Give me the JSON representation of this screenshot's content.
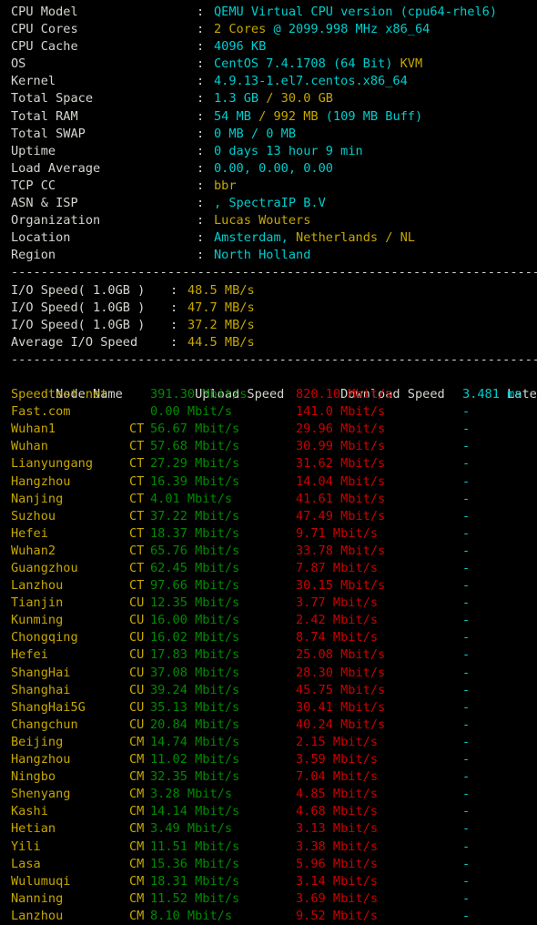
{
  "terminal": {
    "background": "#000000",
    "colors": {
      "white": "#d3d7cf",
      "cyan": "#00cdcd",
      "yellow": "#c6a700",
      "green": "#008b00",
      "red": "#cd0000"
    },
    "separator": "---------------------------------------------------------------------"
  },
  "system_info": [
    {
      "label": "CPU Model",
      "colon": ":",
      "parts": [
        {
          "text": "QEMU Virtual CPU version (cpu64-rhel6)",
          "color": "cy"
        }
      ]
    },
    {
      "label": "CPU Cores",
      "colon": ":",
      "parts": [
        {
          "text": "2 Cores",
          "color": "ye"
        },
        {
          "text": " @ 2099.998 MHz x86_64",
          "color": "cy"
        }
      ]
    },
    {
      "label": "CPU Cache",
      "colon": ":",
      "parts": [
        {
          "text": "4096 KB",
          "color": "cy"
        }
      ]
    },
    {
      "label": "OS",
      "colon": ":",
      "parts": [
        {
          "text": "CentOS 7.4.1708 (64 Bit) ",
          "color": "cy"
        },
        {
          "text": "KVM",
          "color": "ye"
        }
      ]
    },
    {
      "label": "Kernel",
      "colon": ":",
      "parts": [
        {
          "text": "4.9.13-1.el7.centos.x86_64",
          "color": "cy"
        }
      ]
    },
    {
      "label": "Total Space",
      "colon": ":",
      "parts": [
        {
          "text": "1.3 GB ",
          "color": "cy"
        },
        {
          "text": "/ 30.0 GB",
          "color": "ye"
        }
      ]
    },
    {
      "label": "Total RAM",
      "colon": ":",
      "parts": [
        {
          "text": "54 MB ",
          "color": "cy"
        },
        {
          "text": "/ 992 MB ",
          "color": "ye"
        },
        {
          "text": "(109 MB Buff)",
          "color": "cy"
        }
      ]
    },
    {
      "label": "Total SWAP",
      "colon": ":",
      "parts": [
        {
          "text": "0 MB / 0 MB",
          "color": "cy"
        }
      ]
    },
    {
      "label": "Uptime",
      "colon": ":",
      "parts": [
        {
          "text": "0 days 13 hour 9 min",
          "color": "cy"
        }
      ]
    },
    {
      "label": "Load Average",
      "colon": ":",
      "parts": [
        {
          "text": "0.00, 0.00, 0.00",
          "color": "cy"
        }
      ]
    },
    {
      "label": "TCP CC",
      "colon": ":",
      "parts": [
        {
          "text": "bbr",
          "color": "ye"
        }
      ]
    },
    {
      "label": "ASN & ISP",
      "colon": ":",
      "parts": [
        {
          "text": ", SpectraIP B.V",
          "color": "cy"
        }
      ]
    },
    {
      "label": "Organization",
      "colon": ":",
      "parts": [
        {
          "text": "Lucas Wouters",
          "color": "ye"
        }
      ]
    },
    {
      "label": "Location",
      "colon": ":",
      "parts": [
        {
          "text": "Amsterdam, ",
          "color": "cy"
        },
        {
          "text": "Netherlands / NL",
          "color": "ye"
        }
      ]
    },
    {
      "label": "Region",
      "colon": ":",
      "parts": [
        {
          "text": "North Holland",
          "color": "cy"
        }
      ]
    }
  ],
  "io_tests": [
    {
      "label": "I/O Speed( 1.0GB )",
      "colon": ":",
      "value": "48.5 MB/s"
    },
    {
      "label": "I/O Speed( 1.0GB )",
      "colon": ":",
      "value": "47.7 MB/s"
    },
    {
      "label": "I/O Speed( 1.0GB )",
      "colon": ":",
      "value": "37.2 MB/s"
    },
    {
      "label": "Average I/O Speed",
      "colon": ":",
      "value": "44.5 MB/s"
    }
  ],
  "speedtest": {
    "headers": {
      "node": "Node Name",
      "isp": "",
      "upload": "Upload Speed",
      "download": "Download Speed",
      "latency": "Latency"
    },
    "rows": [
      {
        "node": "Speedtest.net",
        "isp": "",
        "upload": "391.30 Mbit/s",
        "download": "820.10 Mbit/s",
        "latency": "3.481 ms"
      },
      {
        "node": "Fast.com",
        "isp": "",
        "upload": "0.00 Mbit/s",
        "download": "141.0 Mbit/s",
        "latency": "-"
      },
      {
        "node": "Wuhan1",
        "isp": "CT",
        "upload": "56.67 Mbit/s",
        "download": "29.96 Mbit/s",
        "latency": "-"
      },
      {
        "node": "Wuhan",
        "isp": "CT",
        "upload": "57.68 Mbit/s",
        "download": "30.99 Mbit/s",
        "latency": "-"
      },
      {
        "node": "Lianyungang",
        "isp": "CT",
        "upload": "27.29 Mbit/s",
        "download": "31.62 Mbit/s",
        "latency": "-"
      },
      {
        "node": "Hangzhou",
        "isp": "CT",
        "upload": "16.39 Mbit/s",
        "download": "14.04 Mbit/s",
        "latency": "-"
      },
      {
        "node": "Nanjing",
        "isp": "CT",
        "upload": "4.01 Mbit/s",
        "download": "41.61 Mbit/s",
        "latency": "-"
      },
      {
        "node": "Suzhou",
        "isp": "CT",
        "upload": "37.22 Mbit/s",
        "download": "47.49 Mbit/s",
        "latency": "-"
      },
      {
        "node": "Hefei",
        "isp": "CT",
        "upload": "18.37 Mbit/s",
        "download": "9.71 Mbit/s",
        "latency": "-"
      },
      {
        "node": "Wuhan2",
        "isp": "CT",
        "upload": "65.76 Mbit/s",
        "download": "33.78 Mbit/s",
        "latency": "-"
      },
      {
        "node": "Guangzhou",
        "isp": "CT",
        "upload": "62.45 Mbit/s",
        "download": "7.87 Mbit/s",
        "latency": "-"
      },
      {
        "node": "Lanzhou",
        "isp": "CT",
        "upload": "97.66 Mbit/s",
        "download": "30.15 Mbit/s",
        "latency": "-"
      },
      {
        "node": "Tianjin",
        "isp": "CU",
        "upload": "12.35 Mbit/s",
        "download": "3.77 Mbit/s",
        "latency": "-"
      },
      {
        "node": "Kunming",
        "isp": "CU",
        "upload": "16.00 Mbit/s",
        "download": "2.42 Mbit/s",
        "latency": "-"
      },
      {
        "node": "Chongqing",
        "isp": "CU",
        "upload": "16.02 Mbit/s",
        "download": "8.74 Mbit/s",
        "latency": "-"
      },
      {
        "node": "Hefei",
        "isp": "CU",
        "upload": "17.83 Mbit/s",
        "download": "25.08 Mbit/s",
        "latency": "-"
      },
      {
        "node": "ShangHai",
        "isp": "CU",
        "upload": "37.08 Mbit/s",
        "download": "28.30 Mbit/s",
        "latency": "-"
      },
      {
        "node": "Shanghai",
        "isp": "CU",
        "upload": "39.24 Mbit/s",
        "download": "45.75 Mbit/s",
        "latency": "-"
      },
      {
        "node": "ShangHai5G",
        "isp": "CU",
        "upload": "35.13 Mbit/s",
        "download": "30.41 Mbit/s",
        "latency": "-"
      },
      {
        "node": "Changchun",
        "isp": "CU",
        "upload": "20.84 Mbit/s",
        "download": "40.24 Mbit/s",
        "latency": "-"
      },
      {
        "node": "Beijing",
        "isp": "CM",
        "upload": "14.74 Mbit/s",
        "download": "2.15 Mbit/s",
        "latency": "-"
      },
      {
        "node": "Hangzhou",
        "isp": "CM",
        "upload": "11.02 Mbit/s",
        "download": "3.59 Mbit/s",
        "latency": "-"
      },
      {
        "node": "Ningbo",
        "isp": "CM",
        "upload": "32.35 Mbit/s",
        "download": "7.04 Mbit/s",
        "latency": "-"
      },
      {
        "node": "Shenyang",
        "isp": "CM",
        "upload": "3.28 Mbit/s",
        "download": "4.85 Mbit/s",
        "latency": "-"
      },
      {
        "node": "Kashi",
        "isp": "CM",
        "upload": "14.14 Mbit/s",
        "download": "4.68 Mbit/s",
        "latency": "-"
      },
      {
        "node": "Hetian",
        "isp": "CM",
        "upload": "3.49 Mbit/s",
        "download": "3.13 Mbit/s",
        "latency": "-"
      },
      {
        "node": "Yili",
        "isp": "CM",
        "upload": "11.51 Mbit/s",
        "download": "3.38 Mbit/s",
        "latency": "-"
      },
      {
        "node": "Lasa",
        "isp": "CM",
        "upload": "15.36 Mbit/s",
        "download": "5.96 Mbit/s",
        "latency": "-"
      },
      {
        "node": "Wulumuqi",
        "isp": "CM",
        "upload": "18.31 Mbit/s",
        "download": "3.14 Mbit/s",
        "latency": "-"
      },
      {
        "node": "Nanning",
        "isp": "CM",
        "upload": "11.52 Mbit/s",
        "download": "3.69 Mbit/s",
        "latency": "-"
      },
      {
        "node": "Lanzhou",
        "isp": "CM",
        "upload": "8.10 Mbit/s",
        "download": "9.52 Mbit/s",
        "latency": "-"
      }
    ]
  }
}
